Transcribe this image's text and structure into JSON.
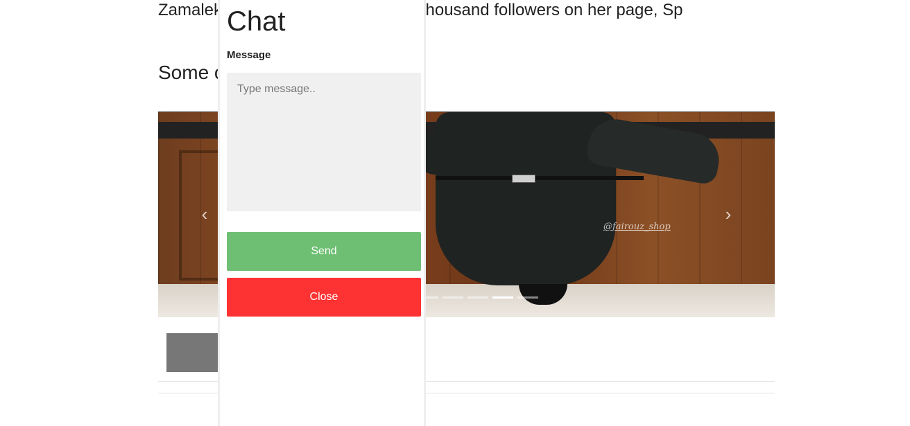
{
  "article": {
    "paragraph": "Zamalek Fairouz has more than 12 thousand followers on her page, Sp",
    "subheading": "Some o"
  },
  "carousel": {
    "watermark": "@fairouz_shop",
    "prev_icon": "‹",
    "next_icon": "›",
    "slide_count": 6,
    "active_slide": 5
  },
  "chat_open_button": {
    "label": "Chat"
  },
  "chat_popup": {
    "title": "Chat",
    "message_label": "Message",
    "message_placeholder": "Type message..",
    "message_value": "",
    "send_label": "Send",
    "close_label": "Close"
  },
  "colors": {
    "send_button": "#6ebf73",
    "close_button": "#fd3232",
    "chat_open_button": "#777777",
    "textarea_bg": "#f0f0f0"
  }
}
